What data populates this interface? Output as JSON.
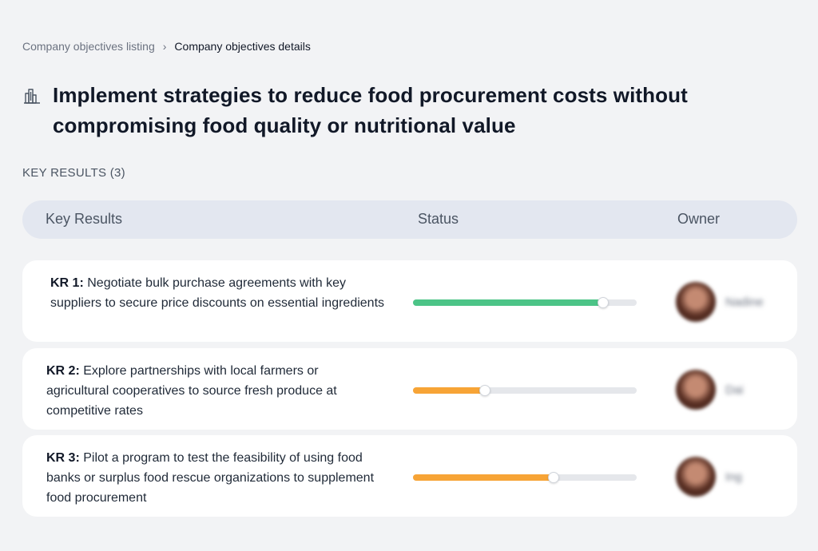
{
  "breadcrumb": {
    "parent": "Company objectives listing",
    "separator": "›",
    "current": "Company objectives details"
  },
  "objective": {
    "icon": "building-icon",
    "title": "Implement strategies to reduce food procurement costs without compromising food quality or nutritional value"
  },
  "key_results_section": {
    "label": "KEY RESULTS (3)"
  },
  "table": {
    "headers": {
      "key_results": "Key Results",
      "status": "Status",
      "owner": "Owner"
    },
    "rows": [
      {
        "label": "KR 1:",
        "text": "Negotiate bulk purchase agreements with key suppliers to secure price discounts on essential ingredients",
        "progress": 0.85,
        "color": "#4cc487",
        "owner": "Nadine"
      },
      {
        "label": "KR 2:",
        "text": "Explore partnerships with local farmers or agricultural cooperatives to source fresh produce at competitive rates",
        "progress": 0.32,
        "color": "#f7a436",
        "owner": "Dai"
      },
      {
        "label": "KR 3:",
        "text": "Pilot a program to test the feasibility of using food banks or surplus food rescue organizations to supplement food procurement",
        "progress": 0.63,
        "color": "#f7a436",
        "owner": "Ing"
      }
    ]
  }
}
